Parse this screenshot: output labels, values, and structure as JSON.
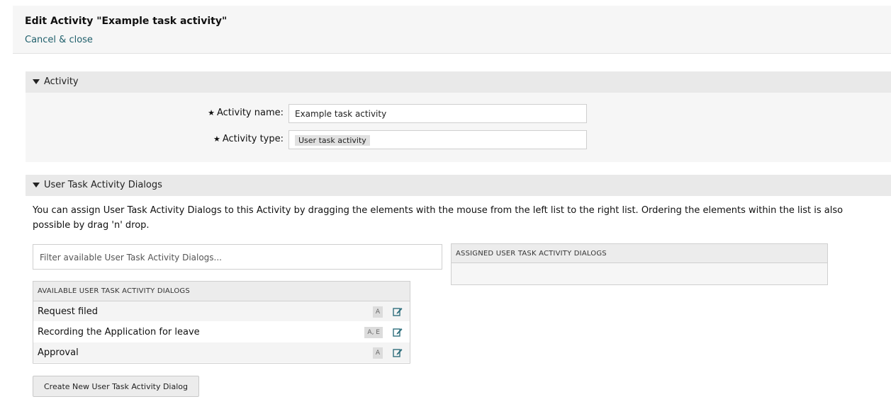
{
  "header": {
    "title": "Edit Activity \"Example task activity\"",
    "cancel_label": "Cancel & close"
  },
  "activity_section": {
    "title": "Activity",
    "name_label": "Activity name:",
    "name_value": "Example task activity",
    "type_label": "Activity type:",
    "type_value": "User task activity",
    "required_marker": "★"
  },
  "dialogs_section": {
    "title": "User Task Activity Dialogs",
    "description": "You can assign User Task Activity Dialogs to this Activity by dragging the elements with the mouse from the left list to the right list. Ordering the elements within the list is also possible by drag 'n' drop.",
    "filter_placeholder": "Filter available User Task Activity Dialogs...",
    "available_header": "AVAILABLE USER TASK ACTIVITY DIALOGS",
    "assigned_header": "ASSIGNED USER TASK ACTIVITY DIALOGS",
    "available_items": [
      {
        "label": "Request filed",
        "badge": "A"
      },
      {
        "label": "Recording the Application for leave",
        "badge": "A, E"
      },
      {
        "label": "Approval",
        "badge": "A"
      }
    ],
    "create_button_label": "Create New User Task Activity Dialog"
  },
  "icons": {
    "section_toggle": "triangle-down-icon",
    "edit": "edit-icon"
  }
}
